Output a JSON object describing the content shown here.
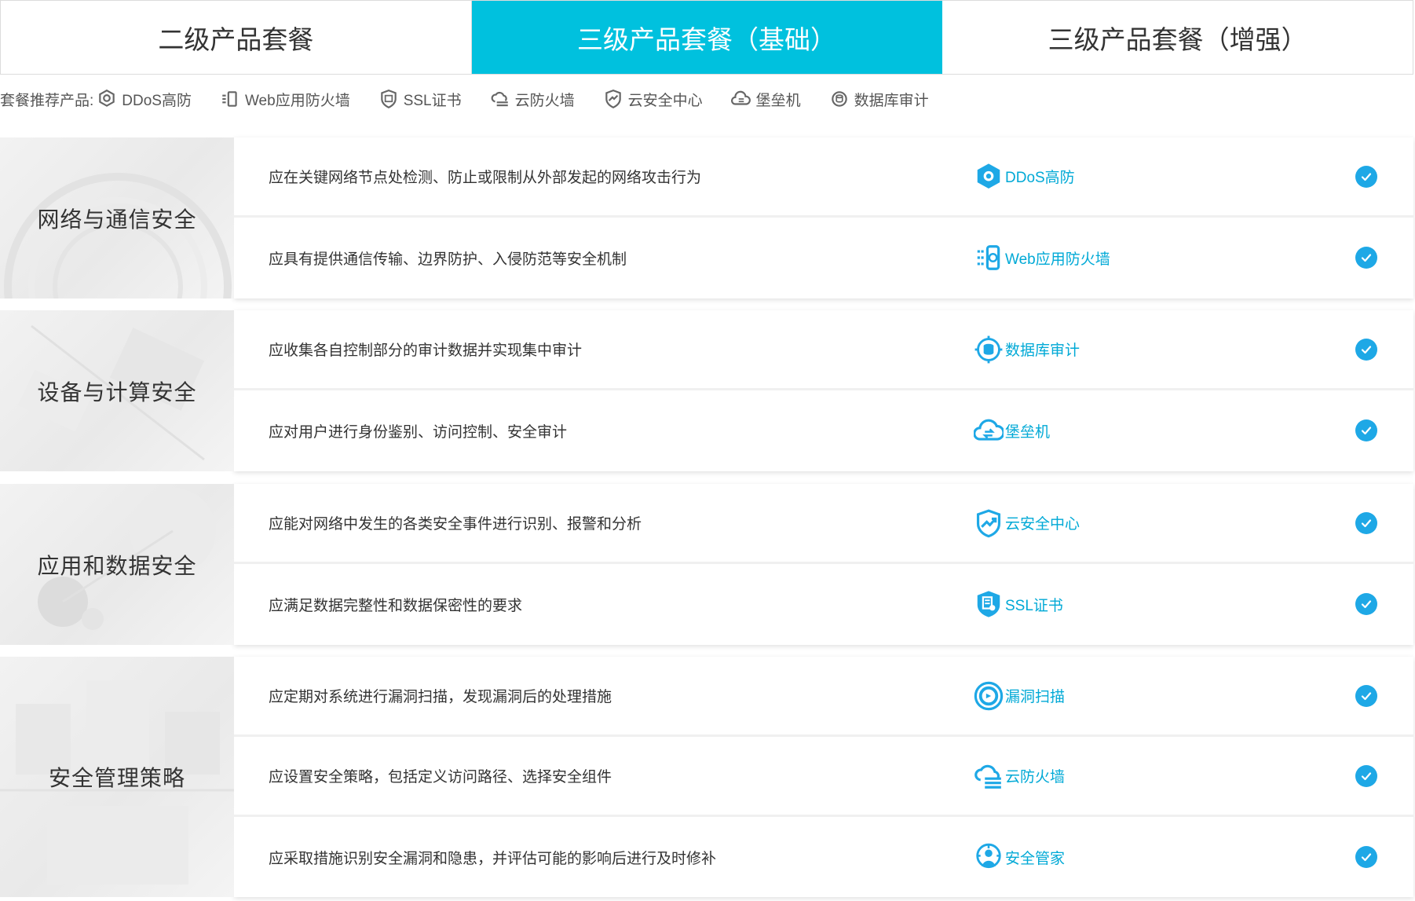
{
  "tabs": [
    {
      "label": "二级产品套餐",
      "active": false
    },
    {
      "label": "三级产品套餐（基础）",
      "active": true
    },
    {
      "label": "三级产品套餐（增强）",
      "active": false
    }
  ],
  "recommend": {
    "label": "套餐推荐产品:",
    "items": [
      {
        "label": "DDoS高防",
        "icon": "ddos-shield-icon"
      },
      {
        "label": "Web应用防火墙",
        "icon": "waf-icon"
      },
      {
        "label": "SSL证书",
        "icon": "ssl-certificate-icon"
      },
      {
        "label": "云防火墙",
        "icon": "cloud-firewall-icon"
      },
      {
        "label": "云安全中心",
        "icon": "security-center-icon"
      },
      {
        "label": "堡垒机",
        "icon": "bastion-host-icon"
      },
      {
        "label": "数据库审计",
        "icon": "database-audit-icon"
      }
    ]
  },
  "groups": [
    {
      "title": "网络与通信安全",
      "rows": [
        {
          "requirement": "应在关键网络节点处检测、防止或限制从外部发起的网络攻击行为",
          "product": "DDoS高防",
          "icon": "ddos-shield-icon"
        },
        {
          "requirement": "应具有提供通信传输、边界防护、入侵防范等安全机制",
          "product": "Web应用防火墙",
          "icon": "waf-icon"
        }
      ]
    },
    {
      "title": "设备与计算安全",
      "rows": [
        {
          "requirement": "应收集各自控制部分的审计数据并实现集中审计",
          "product": "数据库审计",
          "icon": "database-audit-icon"
        },
        {
          "requirement": "应对用户进行身份鉴别、访问控制、安全审计",
          "product": "堡垒机",
          "icon": "bastion-host-icon"
        }
      ]
    },
    {
      "title": "应用和数据安全",
      "rows": [
        {
          "requirement": "应能对网络中发生的各类安全事件进行识别、报警和分析",
          "product": "云安全中心",
          "icon": "security-center-icon"
        },
        {
          "requirement": "应满足数据完整性和数据保密性的要求",
          "product": "SSL证书",
          "icon": "ssl-certificate-icon"
        }
      ]
    },
    {
      "title": "安全管理策略",
      "rows": [
        {
          "requirement": "应定期对系统进行漏洞扫描，发现漏洞后的处理措施",
          "product": "漏洞扫描",
          "icon": "vulnerability-scan-icon"
        },
        {
          "requirement": "应设置安全策略，包括定义访问路径、选择安全组件",
          "product": "云防火墙",
          "icon": "cloud-firewall-icon"
        },
        {
          "requirement": "应采取措施识别安全漏洞和隐患，并评估可能的影响后进行及时修补",
          "product": "安全管家",
          "icon": "security-butler-icon"
        }
      ]
    }
  ],
  "colors": {
    "accent": "#00c1de",
    "product_text": "#00a9d6",
    "check": "#1ea8e6"
  }
}
